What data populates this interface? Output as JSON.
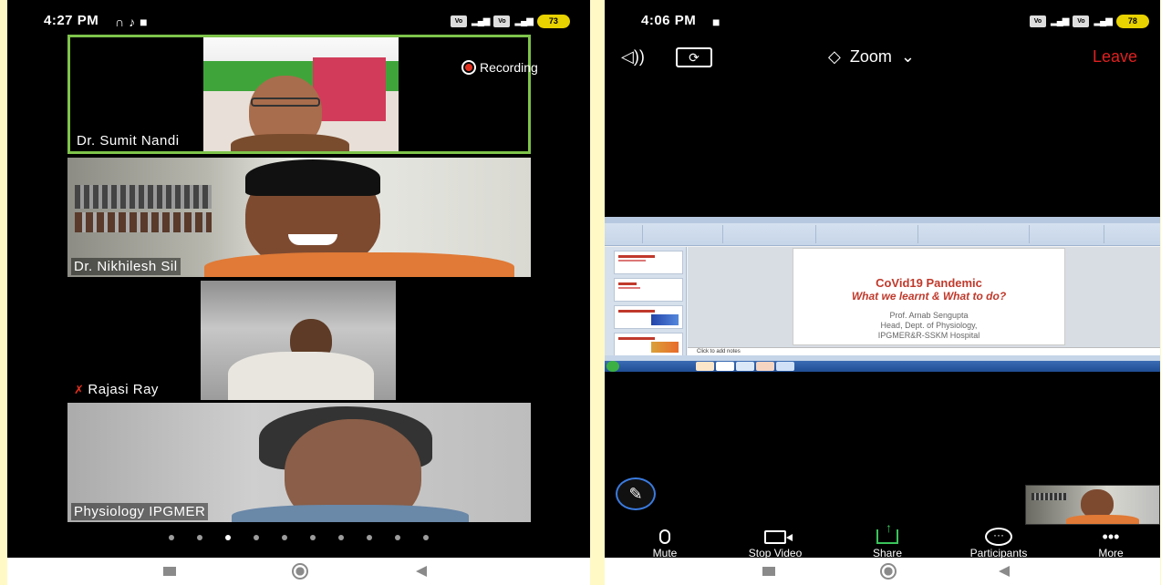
{
  "left_phone": {
    "status": {
      "time": "4:27 PM",
      "battery": "73"
    },
    "recording_label": "Recording",
    "participants": [
      {
        "name": "Dr. Sumit Nandi",
        "active": true,
        "muted": false
      },
      {
        "name": "Dr. Nikhilesh Sil",
        "active": false,
        "muted": false
      },
      {
        "name": "Rajasi Ray",
        "active": false,
        "muted": true
      },
      {
        "name": "Physiology IPGMER",
        "active": false,
        "muted": false
      }
    ],
    "page_dots": {
      "count": 10,
      "active_index": 2
    }
  },
  "right_phone": {
    "status": {
      "time": "4:06 PM",
      "battery": "78"
    },
    "app_title": "Zoom",
    "leave_label": "Leave",
    "shared_slide": {
      "title": "CoVid19 Pandemic",
      "subtitle": "What we learnt & What to do?",
      "author": "Prof. Arnab Sengupta",
      "role": "Head, Dept. of Physiology,",
      "hospital": "IPGMER&R-SSKM Hospital",
      "notes_placeholder": "Click to add notes"
    },
    "toolbar": {
      "mute": "Mute",
      "stop_video": "Stop Video",
      "share": "Share",
      "participants": "Participants",
      "more": "More"
    }
  },
  "colors": {
    "background": "#fff9c6",
    "active_border": "#7ec44a",
    "leave": "#e02020",
    "share_green": "#39c35a",
    "slide_red": "#c0392b"
  }
}
